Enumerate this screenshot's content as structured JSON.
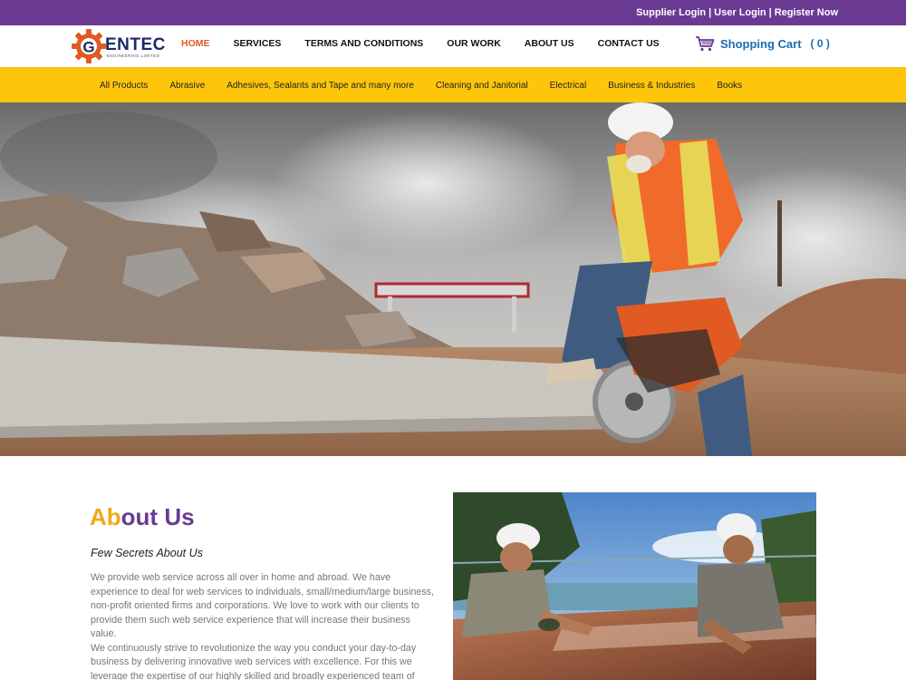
{
  "topbar": {
    "supplier_login": "Supplier Login",
    "user_login": "User Login",
    "register": "Register Now",
    "separator": "|"
  },
  "brand": {
    "logo_letter": "G",
    "logo_text": "ENTEC",
    "logo_subtext": "ENGINEERING LIMITED",
    "purple": "#6a3a93",
    "yellow": "#fec60b",
    "orange": "#e05a22"
  },
  "nav": {
    "items": [
      {
        "label": "HOME",
        "active": true
      },
      {
        "label": "SERVICES",
        "active": false
      },
      {
        "label": "TERMS AND CONDITIONS",
        "active": false
      },
      {
        "label": "OUR WORK",
        "active": false
      },
      {
        "label": "ABOUT US",
        "active": false
      },
      {
        "label": "CONTACT US",
        "active": false
      }
    ]
  },
  "cart": {
    "icon": "shopping-cart-icon",
    "label": "Shopping Cart",
    "count": "( 0 )"
  },
  "categories": [
    "All Products",
    "Abrasive",
    "Adhesives, Sealants and Tape and many more",
    "Cleaning and Janitorial",
    "Electrical",
    "Business & Industries",
    "Books"
  ],
  "about": {
    "title_accent": "Ab",
    "title_rest": "out Us",
    "subtitle": "Few Secrets About Us",
    "paragraph1": "We provide web service across all over in home and abroad. We have experience to deal for web services to individuals, small/medium/large business, non-profit oriented firms and corporations. We love to work with our clients to provide them such web service experience that will increase their business value.",
    "paragraph2": "We continuously strive to revolutionize the way you conduct your day-to-day business by delivering innovative web services with excellence. For this we leverage the expertise of our highly skilled and broadly experienced team of"
  }
}
